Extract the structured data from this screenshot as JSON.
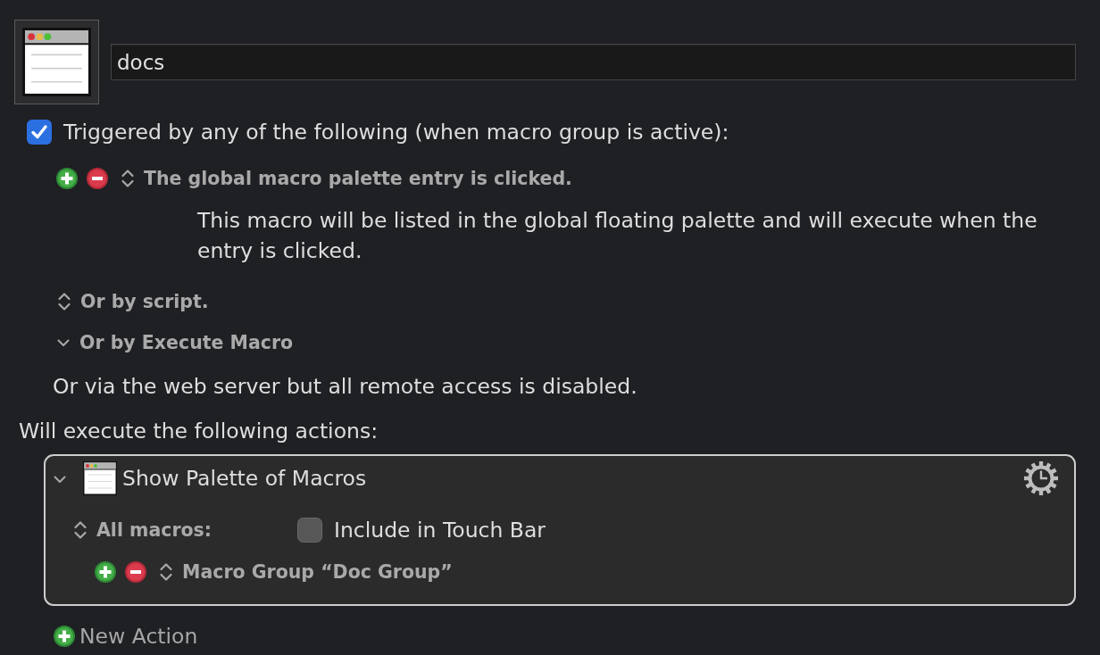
{
  "macro": {
    "name": "docs"
  },
  "triggers": {
    "enabled": true,
    "label": "Triggered by any of the following (when macro group is active):",
    "items": [
      {
        "title": "The global macro palette entry is clicked.",
        "description": "This macro will be listed in the global floating palette and will execute when the entry is clicked."
      }
    ]
  },
  "options": [
    {
      "kind": "popup",
      "label": "Or by script."
    },
    {
      "kind": "disclosure",
      "label": "Or by Execute Macro",
      "expanded": true
    }
  ],
  "remote_note": "Or via the web server but all remote access is disabled.",
  "actions_heading": "Will execute the following actions:",
  "actions": [
    {
      "title": "Show Palette of Macros",
      "expanded": true,
      "scope": "All macros:",
      "touch_bar": {
        "label": "Include in Touch Bar",
        "checked": false
      },
      "groups": [
        {
          "label": "Macro Group “Doc Group”"
        }
      ]
    }
  ],
  "new_action": "New Action"
}
